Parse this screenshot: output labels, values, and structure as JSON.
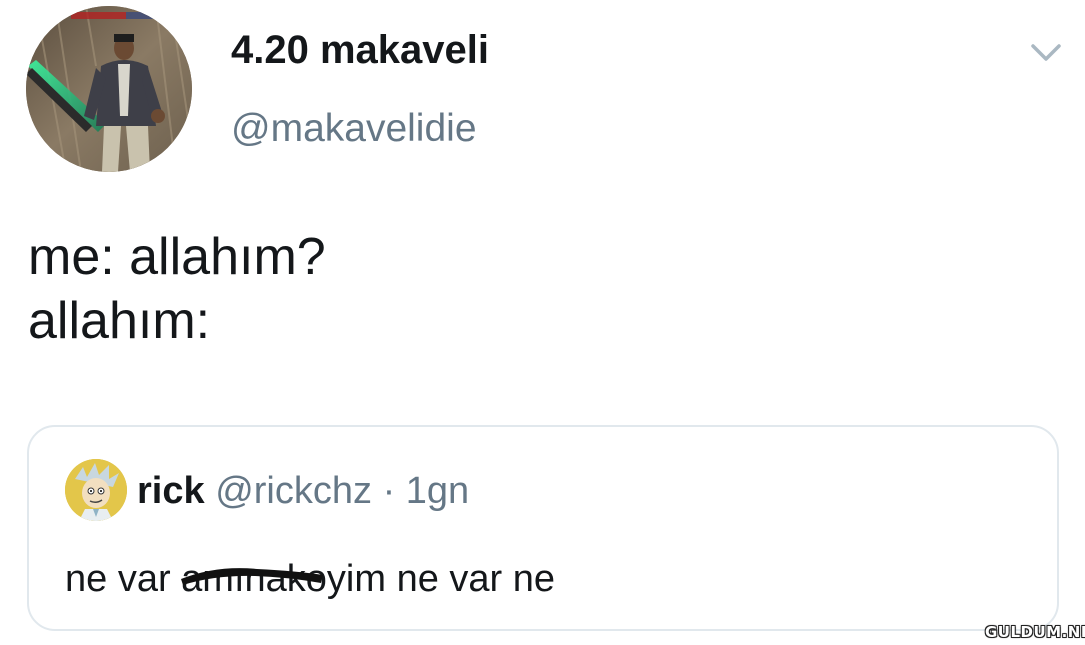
{
  "author": {
    "display_name": "4.20 makaveli",
    "handle": "@makavelidie",
    "avatar_icon": "game-character-with-sword-avatar"
  },
  "menu": {
    "icon": "chevron-down-icon"
  },
  "tweet": {
    "lines": [
      "me: allahım?",
      "allahım:"
    ]
  },
  "quoted_tweet": {
    "display_name": "rick",
    "handle": "@rickchz",
    "separator": "·",
    "time": "1gn",
    "avatar_icon": "cartoon-scientist-avatar",
    "text_before": "ne var ",
    "text_redacted": "amına",
    "text_after": "koyim ne var ne"
  },
  "watermark": {
    "text": "GULDUM.NET"
  },
  "colors": {
    "text_primary": "#14171a",
    "text_secondary": "#657786",
    "card_border": "#e1e8ed",
    "background": "#ffffff"
  }
}
